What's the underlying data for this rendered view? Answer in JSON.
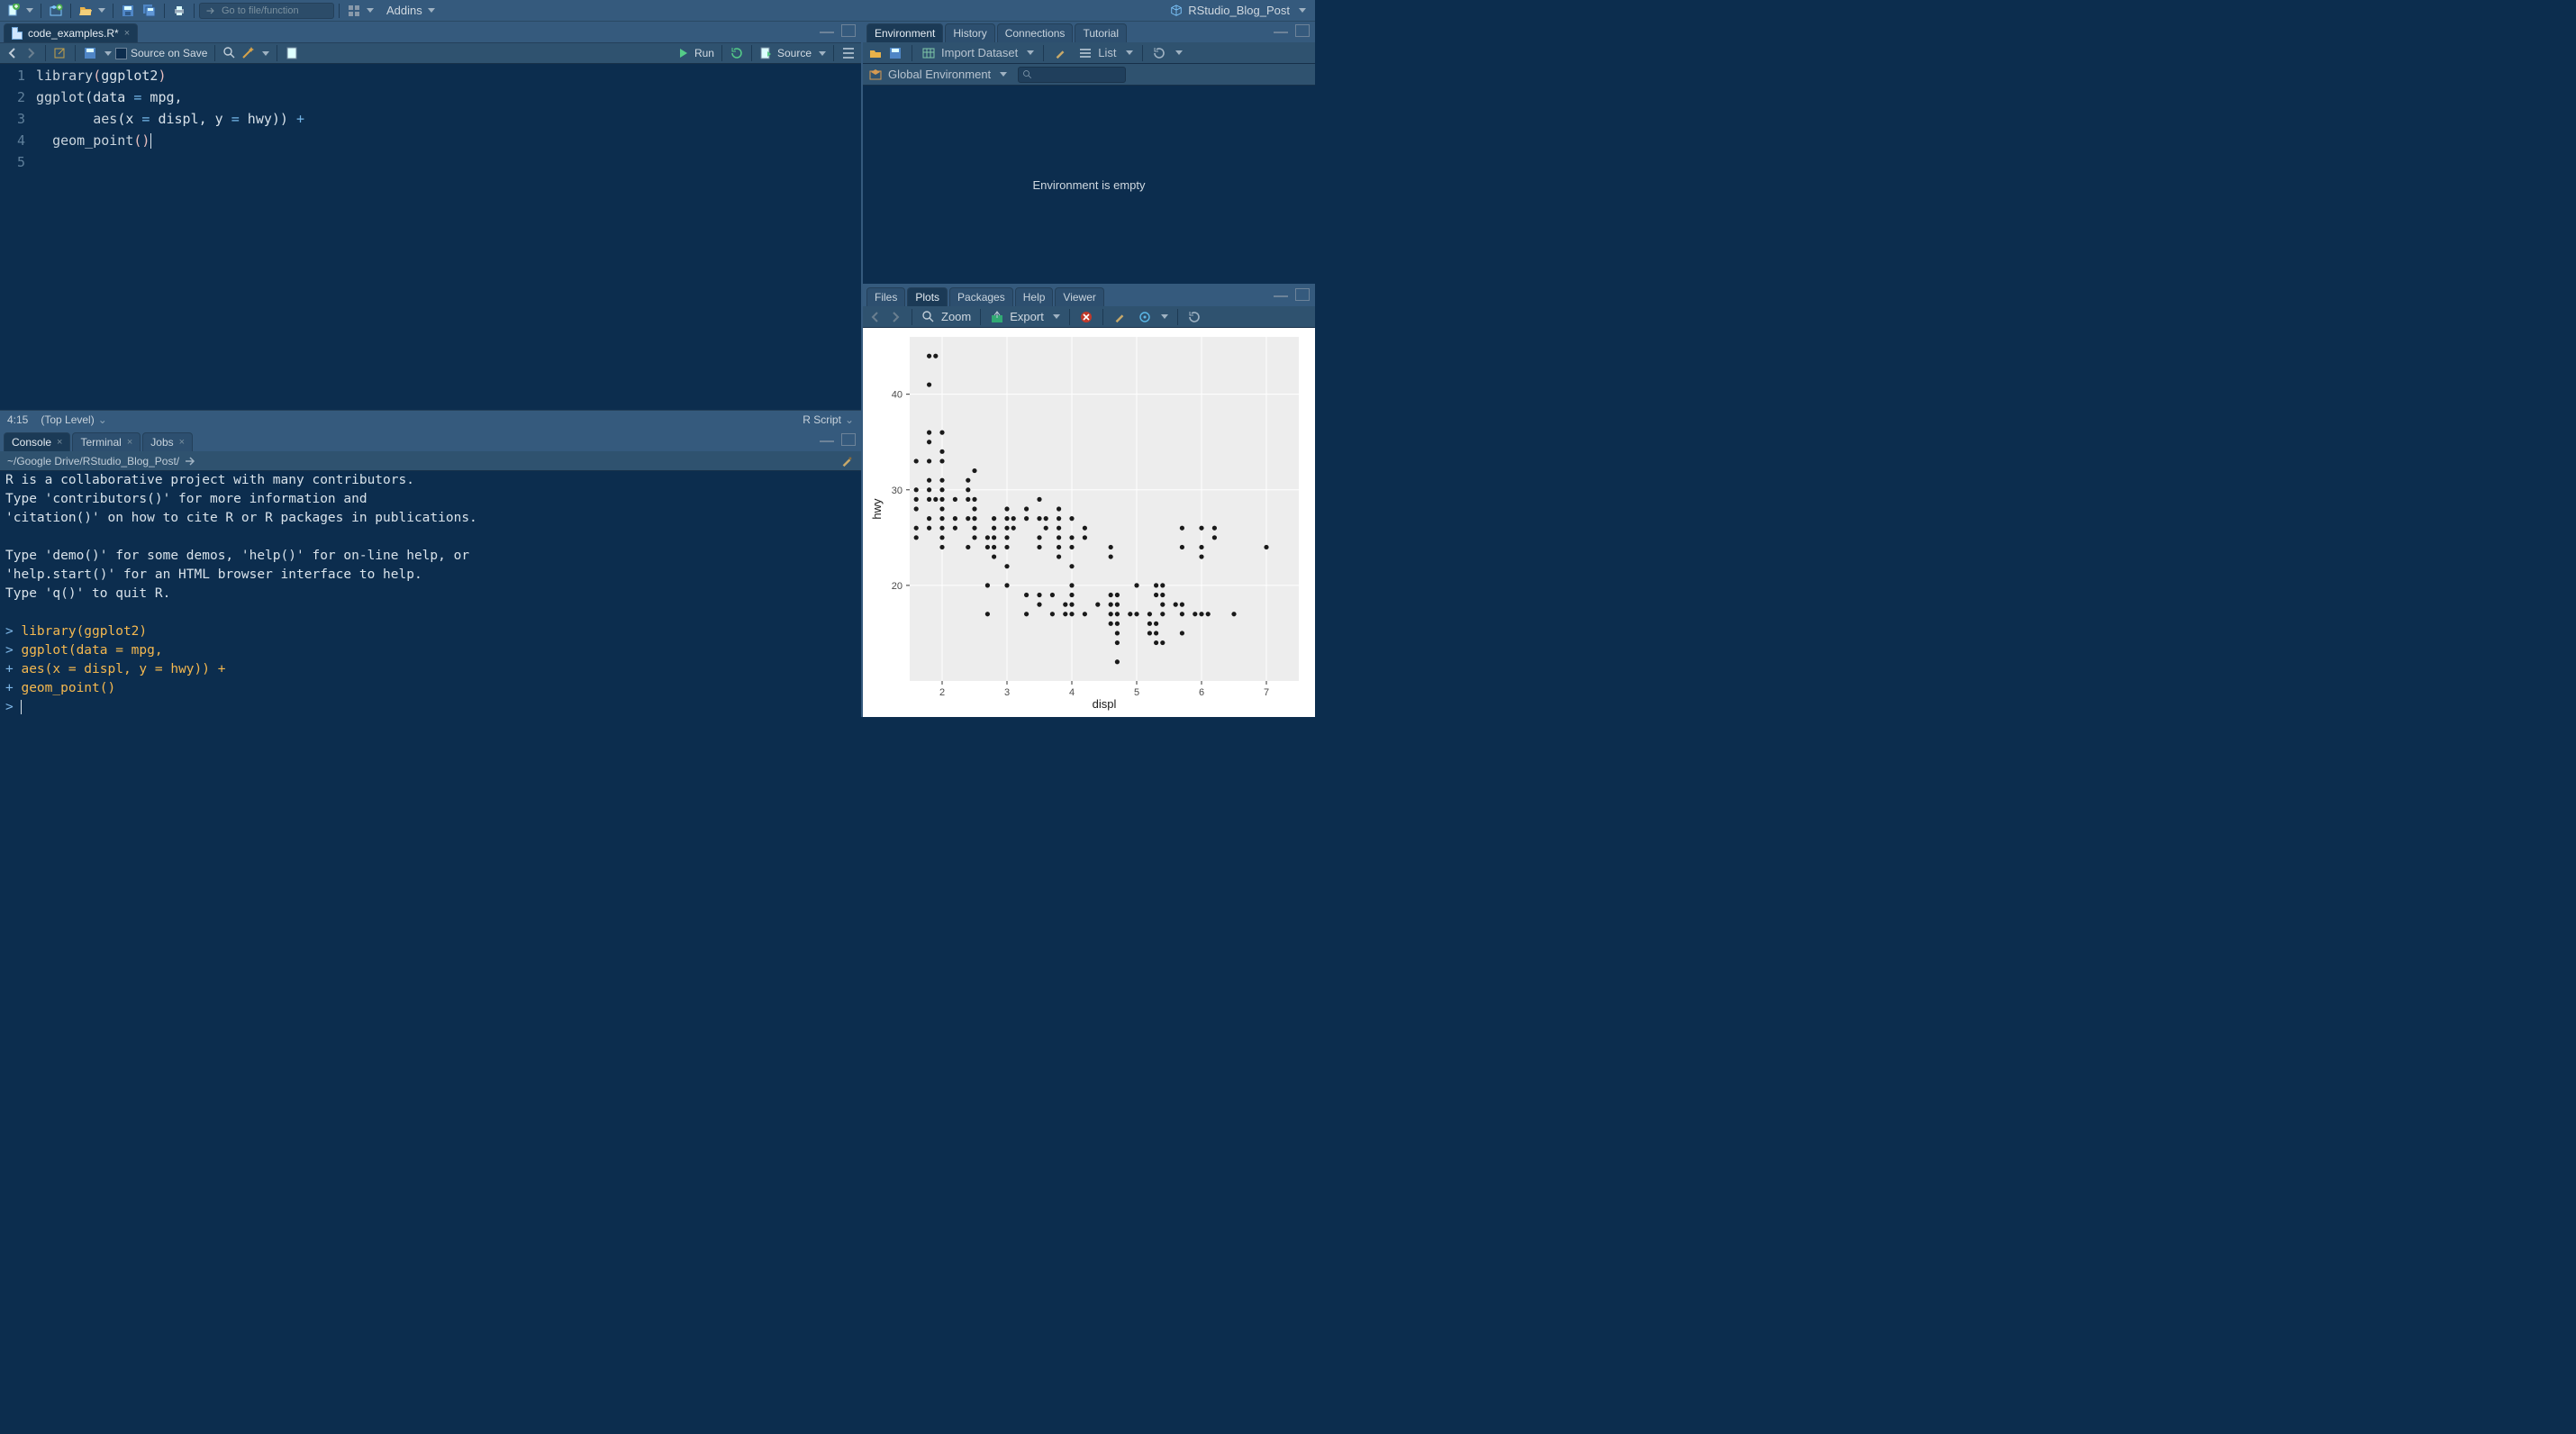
{
  "main_toolbar": {
    "gotofile_placeholder": "Go to file/function",
    "addins_label": "Addins",
    "project_name": "RStudio_Blog_Post"
  },
  "source": {
    "tab_label": "code_examples.R*",
    "source_on_save": "Source on Save",
    "run_label": "Run",
    "source_label": "Source",
    "lines": [
      {
        "n": "1",
        "fn": "library",
        "l": "(",
        "arg": "ggplot2",
        "r": ")"
      },
      {
        "n": "2",
        "fn": "ggplot",
        "text": "(data = mpg,"
      },
      {
        "n": "3",
        "text": "       aes(x = displ, y = hwy)) +"
      },
      {
        "n": "4",
        "fn": "  geom_point",
        "l": "(",
        "r": ")"
      },
      {
        "n": "5",
        "text": ""
      }
    ],
    "status_pos": "4:15",
    "status_scope": "(Top Level)",
    "status_lang": "R Script"
  },
  "console": {
    "tabs": [
      "Console",
      "Terminal",
      "Jobs"
    ],
    "active_tab": 0,
    "path": "~/Google Drive/RStudio_Blog_Post/",
    "lines": [
      "R is a collaborative project with many contributors.",
      "Type 'contributors()' for more information and",
      "'citation()' on how to cite R or R packages in publications.",
      "",
      "Type 'demo()' for some demos, 'help()' for on-line help, or",
      "'help.start()' for an HTML browser interface to help.",
      "Type 'q()' to quit R.",
      ""
    ],
    "entries": [
      {
        "p": ">",
        "t": "library(ggplot2)"
      },
      {
        "p": ">",
        "t": "ggplot(data = mpg,"
      },
      {
        "p": "+",
        "t": "       aes(x = displ, y = hwy)) +"
      },
      {
        "p": "+",
        "t": "  geom_point()"
      },
      {
        "p": ">",
        "t": ""
      }
    ]
  },
  "env": {
    "tabs": [
      "Environment",
      "History",
      "Connections",
      "Tutorial"
    ],
    "active_tab": 0,
    "import_label": "Import Dataset",
    "list_label": "List",
    "scope_label": "Global Environment",
    "empty_text": "Environment is empty"
  },
  "plots": {
    "tabs": [
      "Files",
      "Plots",
      "Packages",
      "Help",
      "Viewer"
    ],
    "active_tab": 1,
    "zoom_label": "Zoom",
    "export_label": "Export"
  },
  "chart_data": {
    "type": "scatter",
    "xlabel": "displ",
    "ylabel": "hwy",
    "xlim": [
      1.5,
      7.5
    ],
    "ylim": [
      10,
      46
    ],
    "x_ticks": [
      2,
      3,
      4,
      5,
      6,
      7
    ],
    "y_ticks": [
      20,
      30,
      40
    ],
    "points": [
      [
        1.6,
        33
      ],
      [
        1.6,
        30
      ],
      [
        1.6,
        29
      ],
      [
        1.6,
        28
      ],
      [
        1.6,
        26
      ],
      [
        1.6,
        25
      ],
      [
        1.8,
        44
      ],
      [
        1.8,
        41
      ],
      [
        1.8,
        36
      ],
      [
        1.8,
        35
      ],
      [
        1.8,
        33
      ],
      [
        1.8,
        31
      ],
      [
        1.8,
        30
      ],
      [
        1.8,
        29
      ],
      [
        1.8,
        27
      ],
      [
        1.8,
        26
      ],
      [
        1.9,
        44
      ],
      [
        1.9,
        29
      ],
      [
        2.0,
        36
      ],
      [
        2.0,
        34
      ],
      [
        2.0,
        33
      ],
      [
        2.0,
        31
      ],
      [
        2.0,
        30
      ],
      [
        2.0,
        29
      ],
      [
        2.0,
        28
      ],
      [
        2.0,
        27
      ],
      [
        2.0,
        26
      ],
      [
        2.0,
        25
      ],
      [
        2.0,
        24
      ],
      [
        2.2,
        29
      ],
      [
        2.2,
        27
      ],
      [
        2.2,
        26
      ],
      [
        2.4,
        31
      ],
      [
        2.4,
        30
      ],
      [
        2.4,
        29
      ],
      [
        2.4,
        27
      ],
      [
        2.4,
        24
      ],
      [
        2.5,
        32
      ],
      [
        2.5,
        29
      ],
      [
        2.5,
        28
      ],
      [
        2.5,
        27
      ],
      [
        2.5,
        26
      ],
      [
        2.5,
        25
      ],
      [
        2.7,
        25
      ],
      [
        2.7,
        24
      ],
      [
        2.7,
        20
      ],
      [
        2.7,
        17
      ],
      [
        2.8,
        27
      ],
      [
        2.8,
        26
      ],
      [
        2.8,
        25
      ],
      [
        2.8,
        24
      ],
      [
        2.8,
        23
      ],
      [
        3.0,
        28
      ],
      [
        3.0,
        27
      ],
      [
        3.0,
        26
      ],
      [
        3.0,
        25
      ],
      [
        3.0,
        24
      ],
      [
        3.0,
        22
      ],
      [
        3.0,
        20
      ],
      [
        3.1,
        27
      ],
      [
        3.1,
        26
      ],
      [
        3.3,
        28
      ],
      [
        3.3,
        27
      ],
      [
        3.3,
        19
      ],
      [
        3.3,
        17
      ],
      [
        3.5,
        29
      ],
      [
        3.5,
        27
      ],
      [
        3.5,
        25
      ],
      [
        3.5,
        24
      ],
      [
        3.5,
        19
      ],
      [
        3.5,
        18
      ],
      [
        3.6,
        27
      ],
      [
        3.6,
        26
      ],
      [
        3.7,
        19
      ],
      [
        3.7,
        17
      ],
      [
        3.8,
        28
      ],
      [
        3.8,
        27
      ],
      [
        3.8,
        26
      ],
      [
        3.8,
        25
      ],
      [
        3.8,
        24
      ],
      [
        3.8,
        23
      ],
      [
        3.9,
        18
      ],
      [
        3.9,
        17
      ],
      [
        4.0,
        27
      ],
      [
        4.0,
        25
      ],
      [
        4.0,
        24
      ],
      [
        4.0,
        22
      ],
      [
        4.0,
        20
      ],
      [
        4.0,
        19
      ],
      [
        4.0,
        18
      ],
      [
        4.0,
        17
      ],
      [
        4.2,
        26
      ],
      [
        4.2,
        25
      ],
      [
        4.2,
        17
      ],
      [
        4.4,
        18
      ],
      [
        4.6,
        24
      ],
      [
        4.6,
        23
      ],
      [
        4.6,
        19
      ],
      [
        4.6,
        18
      ],
      [
        4.6,
        17
      ],
      [
        4.6,
        16
      ],
      [
        4.7,
        19
      ],
      [
        4.7,
        18
      ],
      [
        4.7,
        17
      ],
      [
        4.7,
        16
      ],
      [
        4.7,
        15
      ],
      [
        4.7,
        14
      ],
      [
        4.7,
        12
      ],
      [
        4.9,
        17
      ],
      [
        5.0,
        20
      ],
      [
        5.0,
        17
      ],
      [
        5.2,
        17
      ],
      [
        5.2,
        16
      ],
      [
        5.2,
        15
      ],
      [
        5.3,
        20
      ],
      [
        5.3,
        19
      ],
      [
        5.3,
        16
      ],
      [
        5.3,
        15
      ],
      [
        5.3,
        14
      ],
      [
        5.4,
        20
      ],
      [
        5.4,
        19
      ],
      [
        5.4,
        18
      ],
      [
        5.4,
        17
      ],
      [
        5.4,
        14
      ],
      [
        5.6,
        18
      ],
      [
        5.7,
        26
      ],
      [
        5.7,
        24
      ],
      [
        5.7,
        18
      ],
      [
        5.7,
        17
      ],
      [
        5.7,
        15
      ],
      [
        5.9,
        17
      ],
      [
        6.0,
        26
      ],
      [
        6.0,
        24
      ],
      [
        6.0,
        23
      ],
      [
        6.0,
        17
      ],
      [
        6.1,
        17
      ],
      [
        6.2,
        26
      ],
      [
        6.2,
        25
      ],
      [
        6.5,
        17
      ],
      [
        7.0,
        24
      ]
    ]
  }
}
